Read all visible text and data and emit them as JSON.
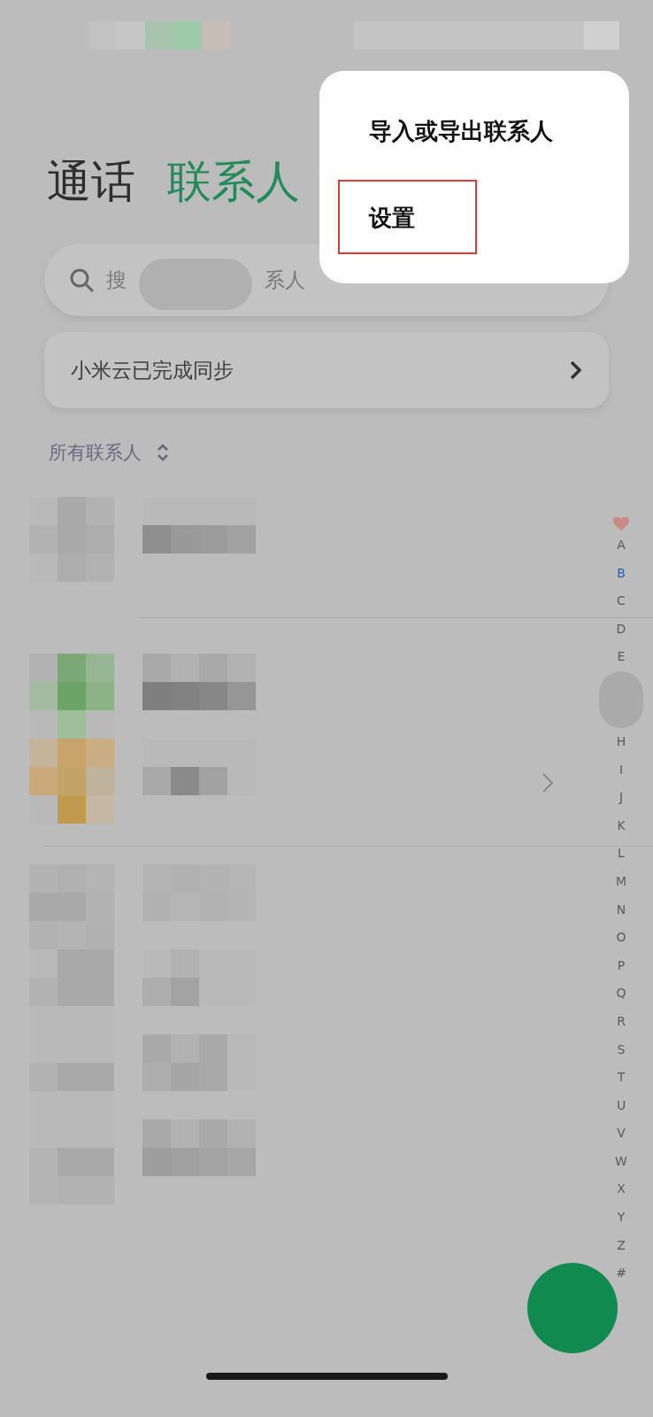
{
  "header": {
    "tabs": [
      {
        "label": "通话",
        "selected": false
      },
      {
        "label": "联系人",
        "selected": true
      }
    ]
  },
  "search": {
    "placeholder_parts": [
      "搜",
      "系人"
    ]
  },
  "sync_banner": {
    "text": "小米云已完成同步"
  },
  "filter": {
    "label": "所有联系人"
  },
  "menu": {
    "items": [
      {
        "label": "导入或导出联系人",
        "highlighted": false
      },
      {
        "label": "设置",
        "highlighted": true
      }
    ]
  },
  "index_bar": {
    "letters": [
      {
        "label": "A",
        "selected": false
      },
      {
        "label": "B",
        "selected": true
      },
      {
        "label": "C",
        "selected": false
      },
      {
        "label": "D",
        "selected": false
      },
      {
        "label": "E",
        "selected": false
      },
      {
        "label": "H",
        "selected": false
      },
      {
        "label": "I",
        "selected": false
      },
      {
        "label": "J",
        "selected": false
      },
      {
        "label": "K",
        "selected": false
      },
      {
        "label": "L",
        "selected": false
      },
      {
        "label": "M",
        "selected": false
      },
      {
        "label": "N",
        "selected": false
      },
      {
        "label": "O",
        "selected": false
      },
      {
        "label": "P",
        "selected": false
      },
      {
        "label": "Q",
        "selected": false
      },
      {
        "label": "R",
        "selected": false
      },
      {
        "label": "S",
        "selected": false
      },
      {
        "label": "T",
        "selected": false
      },
      {
        "label": "U",
        "selected": false
      },
      {
        "label": "V",
        "selected": false
      },
      {
        "label": "W",
        "selected": false
      },
      {
        "label": "X",
        "selected": false
      },
      {
        "label": "Y",
        "selected": false
      },
      {
        "label": "Z",
        "selected": false
      },
      {
        "label": "#",
        "selected": false
      }
    ]
  }
}
